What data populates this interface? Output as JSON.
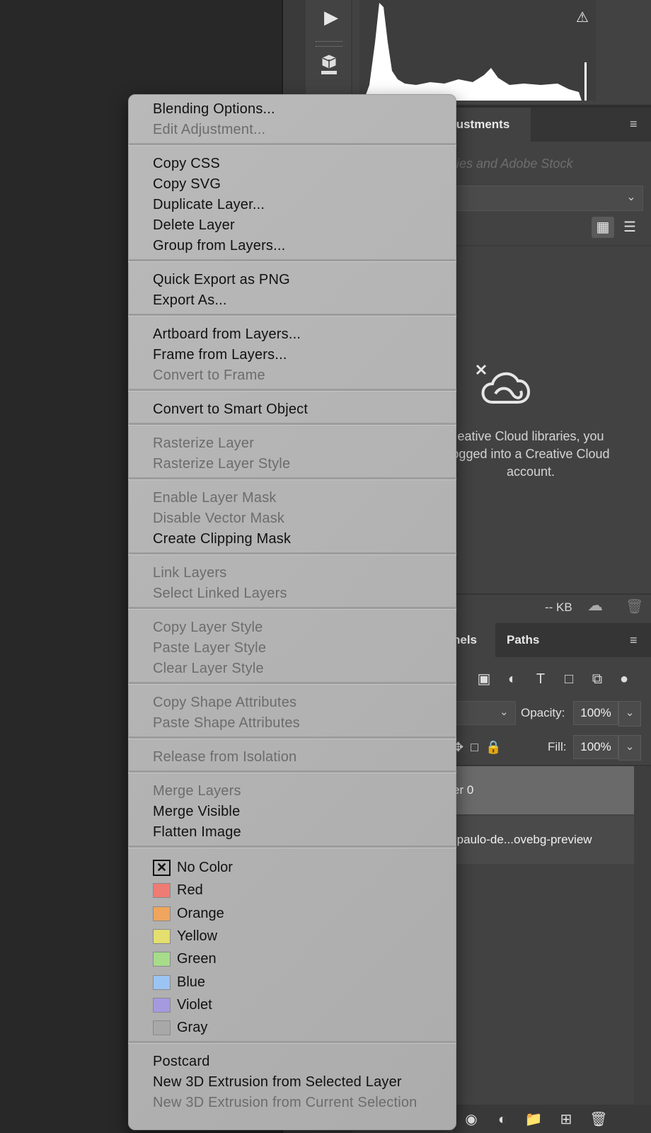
{
  "panels": {
    "adjustments_tab": "justments",
    "library_search_placeholder": "ies and Adobe Stock",
    "cc_message": "eative Cloud libraries, you\nogged into a Creative Cloud\naccount.",
    "kb_label": "-- KB",
    "channels_tab": "nels",
    "paths_tab": "Paths",
    "opacity_label": "Opacity:",
    "opacity_value": "100%",
    "fill_label": "Fill:",
    "fill_value": "100%",
    "layer0_name": "er 0",
    "layer1_name": "-paulo-de...ovebg-preview"
  },
  "context_menu": {
    "groups": [
      [
        {
          "label": "Blending Options...",
          "enabled": true
        },
        {
          "label": "Edit Adjustment...",
          "enabled": false
        }
      ],
      [
        {
          "label": "Copy CSS",
          "enabled": true
        },
        {
          "label": "Copy SVG",
          "enabled": true
        },
        {
          "label": "Duplicate Layer...",
          "enabled": true
        },
        {
          "label": "Delete Layer",
          "enabled": true
        },
        {
          "label": "Group from Layers...",
          "enabled": true
        }
      ],
      [
        {
          "label": "Quick Export as PNG",
          "enabled": true
        },
        {
          "label": "Export As...",
          "enabled": true
        }
      ],
      [
        {
          "label": "Artboard from Layers...",
          "enabled": true
        },
        {
          "label": "Frame from Layers...",
          "enabled": true
        },
        {
          "label": "Convert to Frame",
          "enabled": false
        }
      ],
      [
        {
          "label": "Convert to Smart Object",
          "enabled": true
        }
      ],
      [
        {
          "label": "Rasterize Layer",
          "enabled": false
        },
        {
          "label": "Rasterize Layer Style",
          "enabled": false
        }
      ],
      [
        {
          "label": "Enable Layer Mask",
          "enabled": false
        },
        {
          "label": "Disable Vector Mask",
          "enabled": false
        },
        {
          "label": "Create Clipping Mask",
          "enabled": true
        }
      ],
      [
        {
          "label": "Link Layers",
          "enabled": false
        },
        {
          "label": "Select Linked Layers",
          "enabled": false
        }
      ],
      [
        {
          "label": "Copy Layer Style",
          "enabled": false
        },
        {
          "label": "Paste Layer Style",
          "enabled": false
        },
        {
          "label": "Clear Layer Style",
          "enabled": false
        }
      ],
      [
        {
          "label": "Copy Shape Attributes",
          "enabled": false
        },
        {
          "label": "Paste Shape Attributes",
          "enabled": false
        }
      ],
      [
        {
          "label": "Release from Isolation",
          "enabled": false
        }
      ],
      [
        {
          "label": "Merge Layers",
          "enabled": false
        },
        {
          "label": "Merge Visible",
          "enabled": true
        },
        {
          "label": "Flatten Image",
          "enabled": true
        }
      ]
    ],
    "colors": [
      {
        "label": "No Color",
        "color": null
      },
      {
        "label": "Red",
        "color": "#ee7b74"
      },
      {
        "label": "Orange",
        "color": "#efa55e"
      },
      {
        "label": "Yellow",
        "color": "#e4df6e"
      },
      {
        "label": "Green",
        "color": "#a6dc8a"
      },
      {
        "label": "Blue",
        "color": "#9cc4f2"
      },
      {
        "label": "Violet",
        "color": "#a599e0"
      },
      {
        "label": "Gray",
        "color": "#a8a8a8"
      }
    ],
    "postcard": [
      {
        "label": "Postcard",
        "enabled": true
      },
      {
        "label": "New 3D Extrusion from Selected Layer",
        "enabled": true
      },
      {
        "label": "New 3D Extrusion from Current Selection",
        "enabled": false
      }
    ]
  }
}
